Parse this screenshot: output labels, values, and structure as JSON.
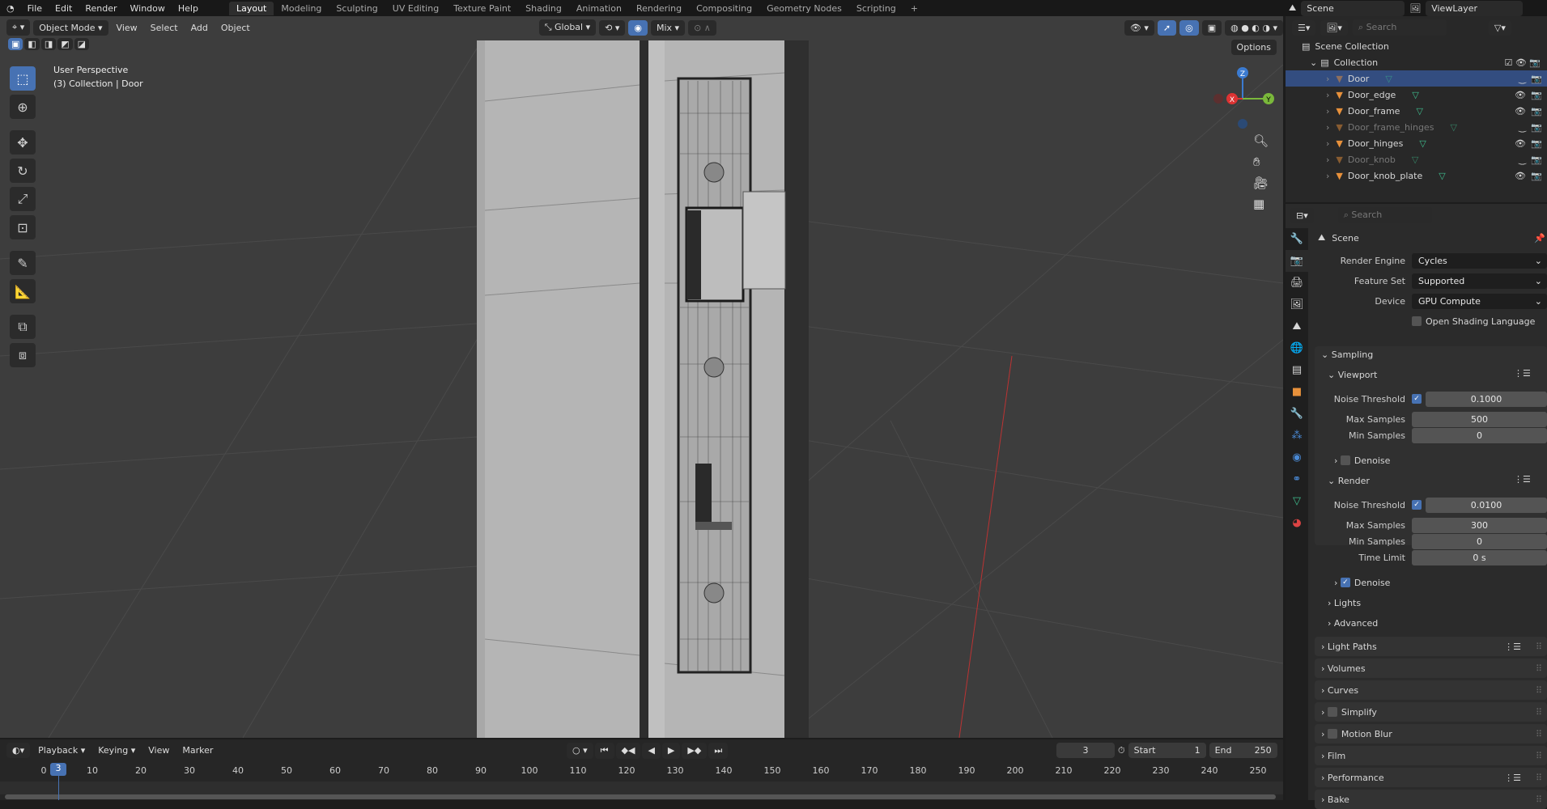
{
  "menu": [
    "File",
    "Edit",
    "Render",
    "Window",
    "Help"
  ],
  "workspaces": [
    "Layout",
    "Modeling",
    "Sculpting",
    "UV Editing",
    "Texture Paint",
    "Shading",
    "Animation",
    "Rendering",
    "Compositing",
    "Geometry Nodes",
    "Scripting"
  ],
  "active_workspace": "Layout",
  "scene_selector": "Scene",
  "viewlayer_selector": "ViewLayer",
  "viewport": {
    "mode": "Object Mode",
    "menus": [
      "View",
      "Select",
      "Add",
      "Object"
    ],
    "transform_orientation": "Global",
    "proportional": "Mix",
    "options_label": "Options",
    "overlay_title": "User Perspective",
    "overlay_subtitle": "(3) Collection | Door",
    "gizmo_axes": {
      "x": "X",
      "y": "Y",
      "z": "Z"
    }
  },
  "outliner": {
    "search_placeholder": "Search",
    "root": "Scene Collection",
    "collection": "Collection",
    "items": [
      {
        "name": "Door",
        "selected": true,
        "visible": false
      },
      {
        "name": "Door_edge",
        "selected": false,
        "visible": true
      },
      {
        "name": "Door_frame",
        "selected": false,
        "visible": true
      },
      {
        "name": "Door_frame_hinges",
        "selected": false,
        "visible": false
      },
      {
        "name": "Door_hinges",
        "selected": false,
        "visible": true
      },
      {
        "name": "Door_knob",
        "selected": false,
        "visible": false
      },
      {
        "name": "Door_knob_plate",
        "selected": false,
        "visible": true
      }
    ]
  },
  "properties": {
    "search_placeholder": "Search",
    "context": "Scene",
    "render_engine": {
      "label": "Render Engine",
      "value": "Cycles"
    },
    "feature_set": {
      "label": "Feature Set",
      "value": "Supported"
    },
    "device": {
      "label": "Device",
      "value": "GPU Compute"
    },
    "osl": {
      "label": "Open Shading Language",
      "checked": false
    },
    "sampling": {
      "label": "Sampling",
      "viewport": {
        "label": "Viewport",
        "noise_threshold_label": "Noise Threshold",
        "noise_threshold": "0.1000",
        "max_samples_label": "Max Samples",
        "max_samples": "500",
        "min_samples_label": "Min Samples",
        "min_samples": "0",
        "denoise_label": "Denoise",
        "denoise": false
      },
      "render": {
        "label": "Render",
        "noise_threshold_label": "Noise Threshold",
        "noise_threshold": "0.0100",
        "max_samples_label": "Max Samples",
        "max_samples": "300",
        "min_samples_label": "Min Samples",
        "min_samples": "0",
        "time_limit_label": "Time Limit",
        "time_limit": "0 s",
        "denoise_label": "Denoise",
        "denoise": true
      },
      "lights": "Lights",
      "advanced": "Advanced"
    },
    "panels": [
      "Light Paths",
      "Volumes",
      "Curves",
      "Simplify",
      "Motion Blur",
      "Film",
      "Performance",
      "Bake"
    ]
  },
  "timeline": {
    "menus": [
      "Playback",
      "Keying",
      "View",
      "Marker"
    ],
    "current_frame": "3",
    "start_label": "Start",
    "start": "1",
    "end_label": "End",
    "end": "250",
    "ticks": [
      "0",
      "10",
      "20",
      "30",
      "40",
      "50",
      "60",
      "70",
      "80",
      "90",
      "100",
      "110",
      "120",
      "130",
      "140",
      "150",
      "160",
      "170",
      "180",
      "190",
      "200",
      "210",
      "220",
      "230",
      "240",
      "250"
    ]
  },
  "colors": {
    "accent": "#4772b3",
    "selection": "#334d80",
    "mesh_icon": "#e8913b",
    "data_icon": "#3fbf8f"
  }
}
